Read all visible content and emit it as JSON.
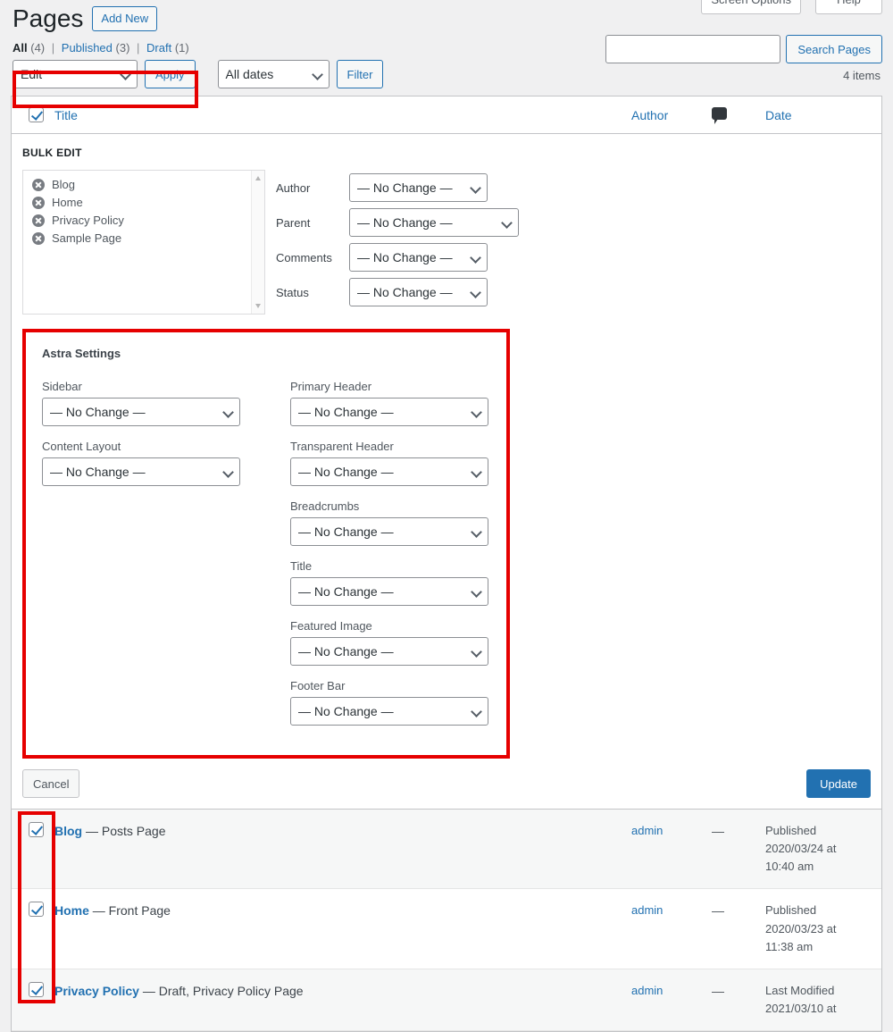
{
  "topbar": {
    "screen_options": "Screen Options",
    "help": "Help"
  },
  "header": {
    "title": "Pages",
    "add_new": "Add New"
  },
  "status_links": [
    {
      "label": "All",
      "count": "(4)",
      "current": true
    },
    {
      "label": "Published",
      "count": "(3)",
      "current": false
    },
    {
      "label": "Draft",
      "count": "(1)",
      "current": false
    }
  ],
  "search": {
    "value": "",
    "placeholder": "",
    "button": "Search Pages"
  },
  "tablenav": {
    "bulk_action": "Edit",
    "apply": "Apply",
    "date_filter": "All dates",
    "filter": "Filter",
    "items": "4 items"
  },
  "table_headers": {
    "title": "Title",
    "author": "Author",
    "comments": "comment-bubble-icon",
    "date": "Date"
  },
  "bulk_edit": {
    "legend": "BULK EDIT",
    "titles": [
      "Blog",
      "Home",
      "Privacy Policy",
      "Sample Page"
    ],
    "fields": [
      {
        "label": "Author",
        "value": "— No Change —",
        "width": 155
      },
      {
        "label": "Parent",
        "value": "— No Change —",
        "width": 190
      },
      {
        "label": "Comments",
        "value": "— No Change —",
        "width": 155
      },
      {
        "label": "Status",
        "value": "— No Change —",
        "width": 155
      }
    ]
  },
  "astra": {
    "heading": "Astra Settings",
    "left_fields": [
      {
        "label": "Sidebar",
        "value": "— No Change —"
      },
      {
        "label": "Content Layout",
        "value": "— No Change —"
      }
    ],
    "right_fields": [
      {
        "label": "Primary Header",
        "value": "— No Change —"
      },
      {
        "label": "Transparent Header",
        "value": "— No Change —"
      },
      {
        "label": "Breadcrumbs",
        "value": "— No Change —"
      },
      {
        "label": "Title",
        "value": "— No Change —"
      },
      {
        "label": "Featured Image",
        "value": "— No Change —"
      },
      {
        "label": "Footer Bar",
        "value": "— No Change —"
      }
    ]
  },
  "submit": {
    "cancel": "Cancel",
    "update": "Update"
  },
  "rows": [
    {
      "checked": true,
      "title": "Blog",
      "suffix": " — Posts Page",
      "author": "admin",
      "comments": "—",
      "date_status": "Published",
      "date_value": "2020/03/24 at",
      "date_time": "10:40 am"
    },
    {
      "checked": true,
      "title": "Home",
      "suffix": " — Front Page",
      "author": "admin",
      "comments": "—",
      "date_status": "Published",
      "date_value": "2020/03/23 at",
      "date_time": "11:38 am"
    },
    {
      "checked": true,
      "title": "Privacy Policy",
      "suffix": " — Draft, Privacy Policy Page",
      "author": "admin",
      "comments": "—",
      "date_status": "Last Modified",
      "date_value": "2021/03/10 at",
      "date_time": ""
    }
  ],
  "colors": {
    "accent": "#2271b1",
    "annotation": "#e60000",
    "page_bg": "#f0f0f1",
    "alt_row": "#f6f7f7"
  }
}
